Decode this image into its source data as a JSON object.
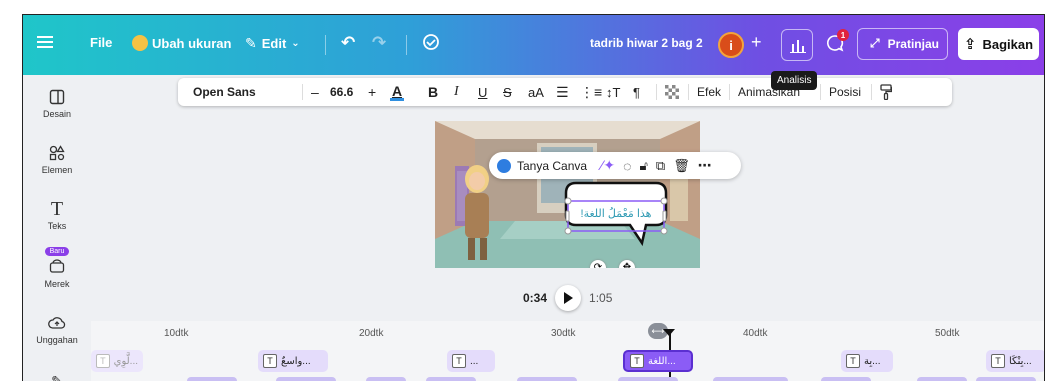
{
  "topbar": {
    "menu_icon": "hamburger-icon",
    "file": "File",
    "resize": "Ubah ukuran",
    "edit": "Edit",
    "project_title": "tadrib hiwar 2 bag 2",
    "avatar_letter": "i",
    "notification_count": "1",
    "preview": "Pratinjau",
    "share": "Bagikan",
    "tooltip": "Analisis"
  },
  "sidebar": {
    "items": [
      {
        "label": "Desain",
        "icon": "layout-icon"
      },
      {
        "label": "Elemen",
        "icon": "shapes-icon"
      },
      {
        "label": "Teks",
        "icon": "text-icon"
      },
      {
        "label": "Merek",
        "icon": "brand-icon",
        "badge": "Baru"
      },
      {
        "label": "Unggahan",
        "icon": "upload-icon"
      }
    ]
  },
  "format_toolbar": {
    "font": "Open Sans",
    "font_size": "66.6",
    "minus": "–",
    "plus": "+",
    "text_color_label": "A",
    "bold": "B",
    "italic": "I",
    "underline": "U",
    "strikethrough": "S",
    "case": "aA",
    "effects": "Efek",
    "animate": "Animasikan",
    "position": "Posisi"
  },
  "context_bar": {
    "ask_canva": "Tanya Canva"
  },
  "canvas": {
    "speech_text": "هذا مَعْمَلُ اللغة!"
  },
  "player": {
    "current": "0:34",
    "total": "1:05"
  },
  "timeline": {
    "ruler": [
      "10dtk",
      "20dtk",
      "30dtk",
      "40dtk",
      "50dtk"
    ],
    "clips": [
      {
        "text": "...لَّوِي",
        "selected": false,
        "faded": true
      },
      {
        "text": "...واسعٌ",
        "selected": false,
        "faded": false
      },
      {
        "text": "...",
        "selected": false,
        "faded": false
      },
      {
        "text": "...اللغة",
        "selected": true,
        "faded": false
      },
      {
        "text": "...بِة",
        "selected": false,
        "faded": false
      },
      {
        "text": "...بِنْكَا",
        "selected": false,
        "faded": false
      }
    ]
  },
  "colors": {
    "accent": "#8b3fe8",
    "teal": "#1fc6c9",
    "clip": "#e4dcfb",
    "clip_selected": "#8b5cf6"
  }
}
